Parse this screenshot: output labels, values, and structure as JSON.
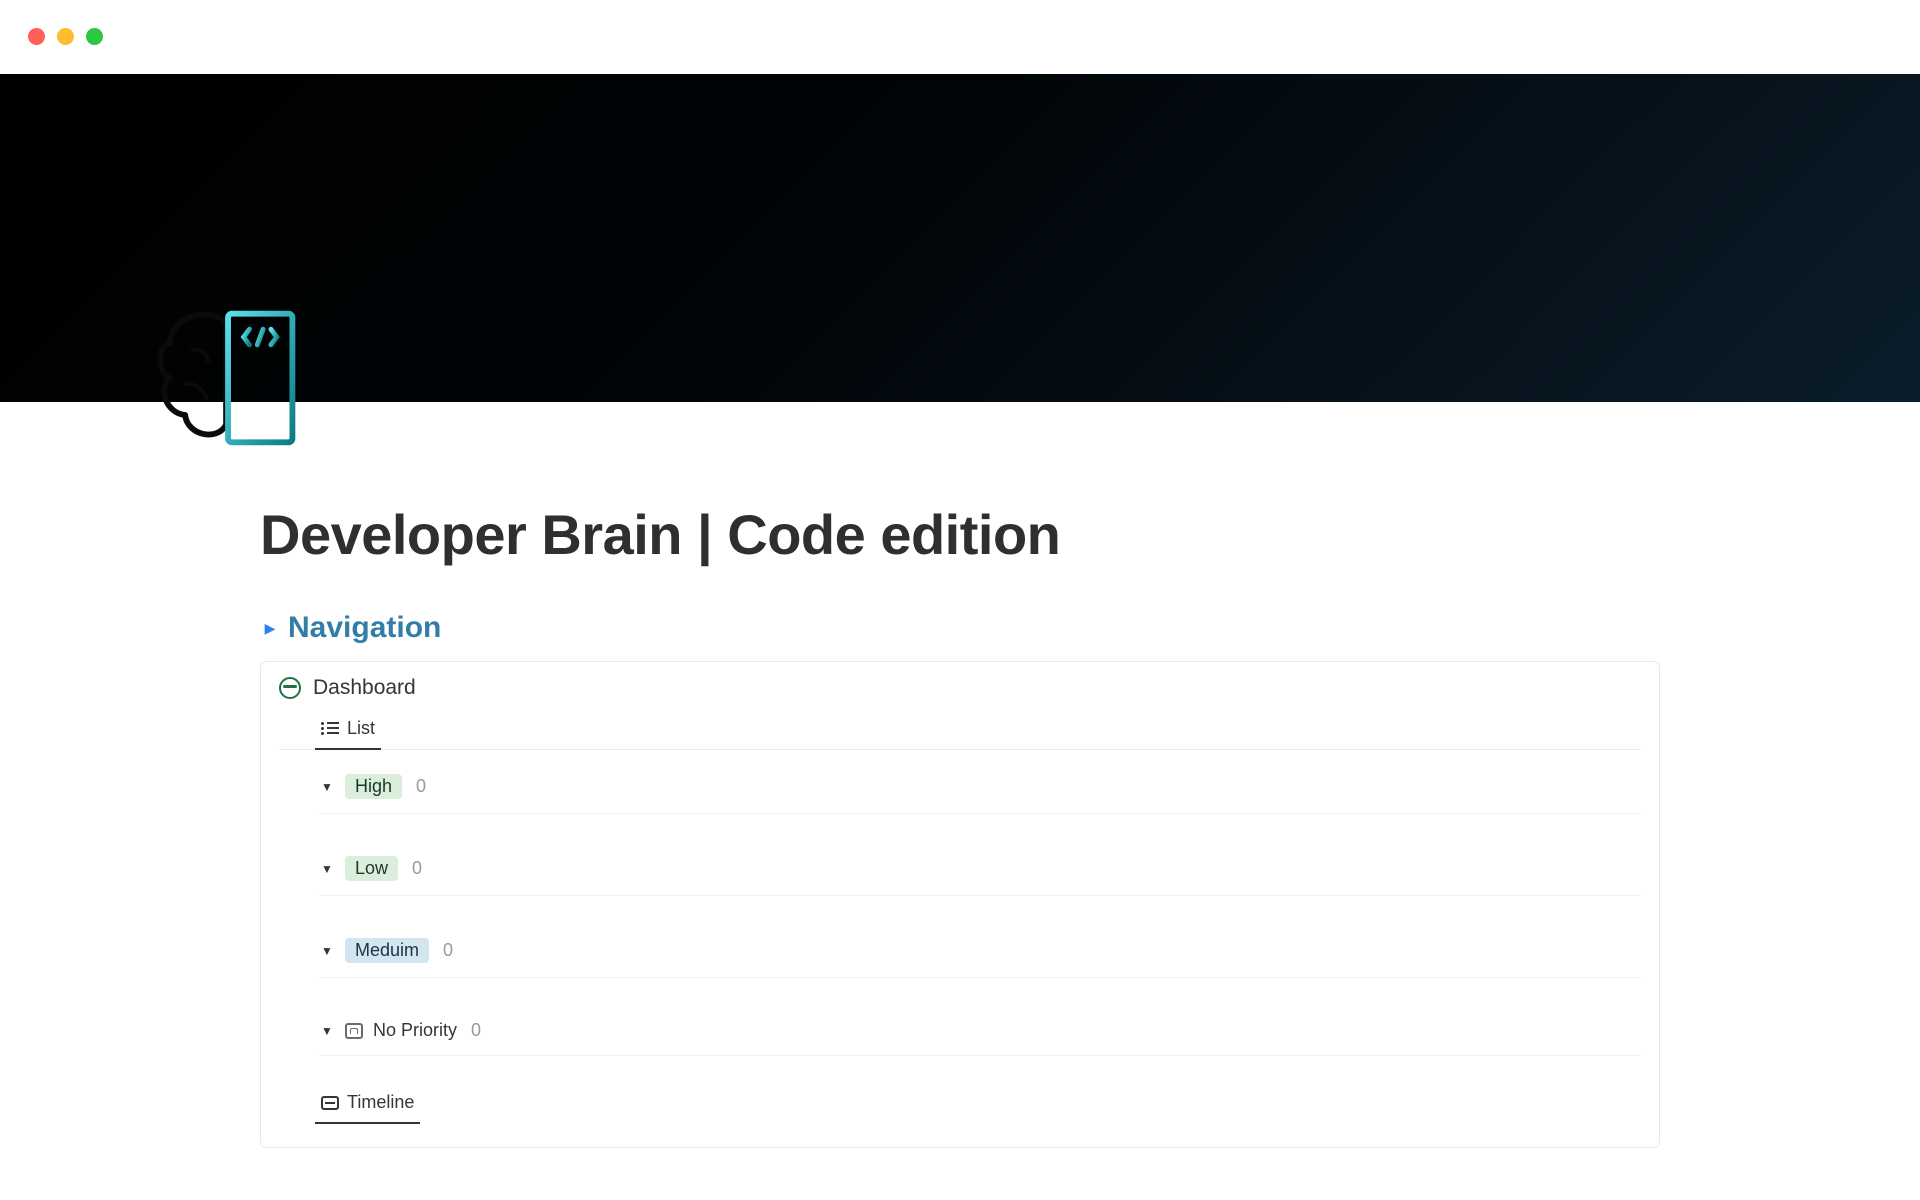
{
  "window": {
    "traffic_lights": [
      "close",
      "minimize",
      "zoom"
    ]
  },
  "page": {
    "title": "Developer Brain | Code edition",
    "icon_name": "brain-code-icon"
  },
  "toggle": {
    "label": "Navigation",
    "expanded": false
  },
  "dashboard": {
    "title": "Dashboard",
    "tabs": [
      {
        "id": "list",
        "label": "List",
        "active": true
      }
    ],
    "groups": [
      {
        "label": "High",
        "count": 0,
        "tag_color": "green"
      },
      {
        "label": "Low",
        "count": 0,
        "tag_color": "green"
      },
      {
        "label": "Meduim",
        "count": 0,
        "tag_color": "blue"
      },
      {
        "label": "No Priority",
        "count": 0,
        "tag_color": "none"
      }
    ],
    "secondary_tabs": [
      {
        "id": "timeline",
        "label": "Timeline",
        "active": true
      }
    ]
  }
}
